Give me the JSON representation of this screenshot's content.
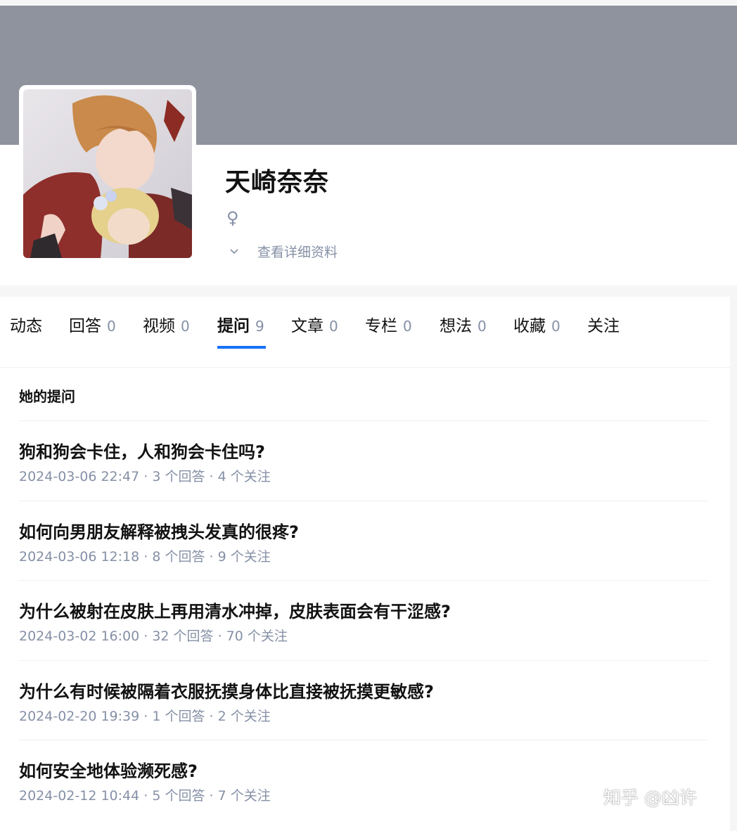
{
  "profile": {
    "name": "天崎奈奈",
    "gender_symbol": "♀",
    "detail_label": "查看详细资料",
    "detail_icon": "chevron-down-icon"
  },
  "tabs": [
    {
      "label": "动态",
      "count": ""
    },
    {
      "label": "回答",
      "count": "0"
    },
    {
      "label": "视频",
      "count": "0"
    },
    {
      "label": "提问",
      "count": "9",
      "active": true
    },
    {
      "label": "文章",
      "count": "0"
    },
    {
      "label": "专栏",
      "count": "0"
    },
    {
      "label": "想法",
      "count": "0"
    },
    {
      "label": "收藏",
      "count": "0"
    },
    {
      "label": "关注",
      "count": ""
    }
  ],
  "questions_section": {
    "title": "她的提问",
    "items": [
      {
        "title": "狗和狗会卡住，人和狗会卡住吗?",
        "meta": "2024-03-06 22:47 · 3 个回答 · 4 个关注"
      },
      {
        "title": "如何向男朋友解释被拽头发真的很疼?",
        "meta": "2024-03-06 12:18 · 8 个回答 · 9 个关注"
      },
      {
        "title": "为什么被射在皮肤上再用清水冲掉，皮肤表面会有干涩感?",
        "meta": "2024-03-02 16:00 · 32 个回答 · 70 个关注"
      },
      {
        "title": "为什么有时候被隔着衣服抚摸身体比直接被抚摸更敏感?",
        "meta": "2024-02-20 19:39 · 1 个回答 · 2 个关注"
      },
      {
        "title": "如何安全地体验濒死感?",
        "meta": "2024-02-12 10:44 · 5 个回答 · 7 个关注"
      }
    ]
  },
  "watermark": "知乎 @凶许",
  "colors": {
    "cover": "#8e939e",
    "accent": "#1772f6",
    "muted_text": "#8590a6"
  }
}
